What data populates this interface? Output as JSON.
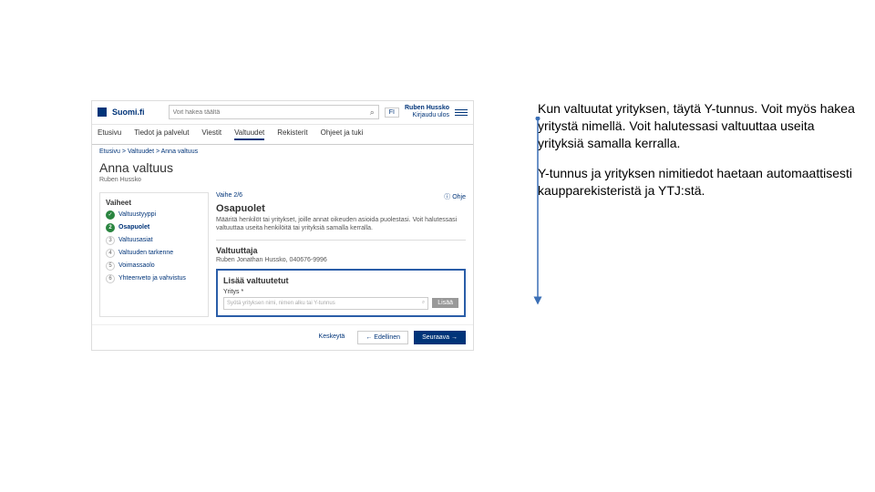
{
  "header": {
    "site_name": "Suomi.fi",
    "search_placeholder": "Voit hakea täältä",
    "lang": "FI",
    "user_name": "Ruben Hussko",
    "user_sub": "Kirjaudu ulos"
  },
  "nav": {
    "items": [
      "Etusivu",
      "Tiedot ja palvelut",
      "Viestit",
      "Valtuudet",
      "Rekisterit",
      "Ohjeet ja tuki"
    ]
  },
  "crumbs": {
    "c1": "Etusivu",
    "c2": "Valtuudet",
    "c3": "Anna valtuus"
  },
  "page": {
    "title": "Anna valtuus",
    "subtitle": "Ruben Hussko"
  },
  "steps": {
    "title": "Vaiheet",
    "items": [
      {
        "num": "1",
        "label": "Valtuustyyppi"
      },
      {
        "num": "2",
        "label": "Osapuolet"
      },
      {
        "num": "3",
        "label": "Valtuusasiat"
      },
      {
        "num": "4",
        "label": "Valtuuden tarkenne"
      },
      {
        "num": "5",
        "label": "Voimassaolo"
      },
      {
        "num": "6",
        "label": "Yhteenveto ja vahvistus"
      }
    ]
  },
  "main": {
    "step_label": "Vaihe 2/6",
    "help": "Ohje",
    "heading": "Osapuolet",
    "desc": "Määritä henkilöt tai yritykset, joille annat oikeuden asioida puolestasi. Voit halutessasi valtuuttaa useita henkilöitä tai yrityksiä samalla kerralla.",
    "val_h": "Valtuuttaja",
    "val_txt": "Ruben Jonathan Hussko, 040676-9996",
    "add_h": "Lisää valtuutetut",
    "add_lbl": "Yritys *",
    "add_ph": "Syötä yrityksen nimi, nimen alku tai Y-tunnus",
    "add_btn": "Lisää"
  },
  "footer": {
    "b1": "Keskeytä",
    "b2": "← Edellinen",
    "b3": "Seuraava →"
  },
  "annotation": {
    "p1": "Kun valtuutat yrityksen, täytä Y-tunnus. Voit myös hakea yritystä nimellä. Voit halutessasi valtuuttaa useita yrityksiä samalla kerralla.",
    "p2": "Y-tunnus ja yrityksen nimitiedot haetaan automaattisesti kaupparekisteristä ja YTJ:stä."
  }
}
